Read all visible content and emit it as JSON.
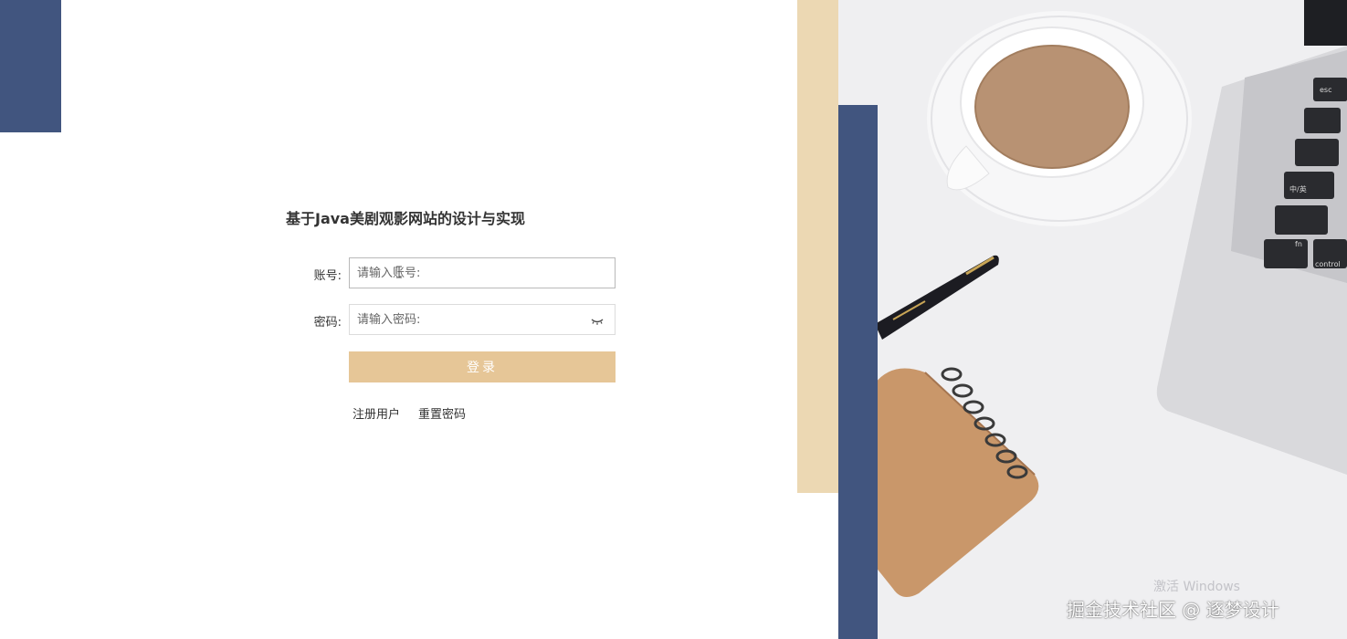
{
  "page": {
    "title": "基于Java美剧观影网站的设计与实现"
  },
  "form": {
    "username_label": "账号:",
    "username_placeholder": "请输入账号:",
    "password_label": "密码:",
    "password_placeholder": "请输入密码:",
    "login_button": "登录",
    "register_link": "注册用户",
    "reset_link": "重置密码"
  },
  "overlay": {
    "activate_windows": "激活 Windows",
    "watermark": "掘金技术社区 @ 逐梦设计"
  },
  "colors": {
    "brand_blue": "#41557f",
    "gold": "#e6c697",
    "gold_light": "#ecd8b3"
  },
  "icons": {
    "password_toggle": "eye-closed-icon"
  }
}
